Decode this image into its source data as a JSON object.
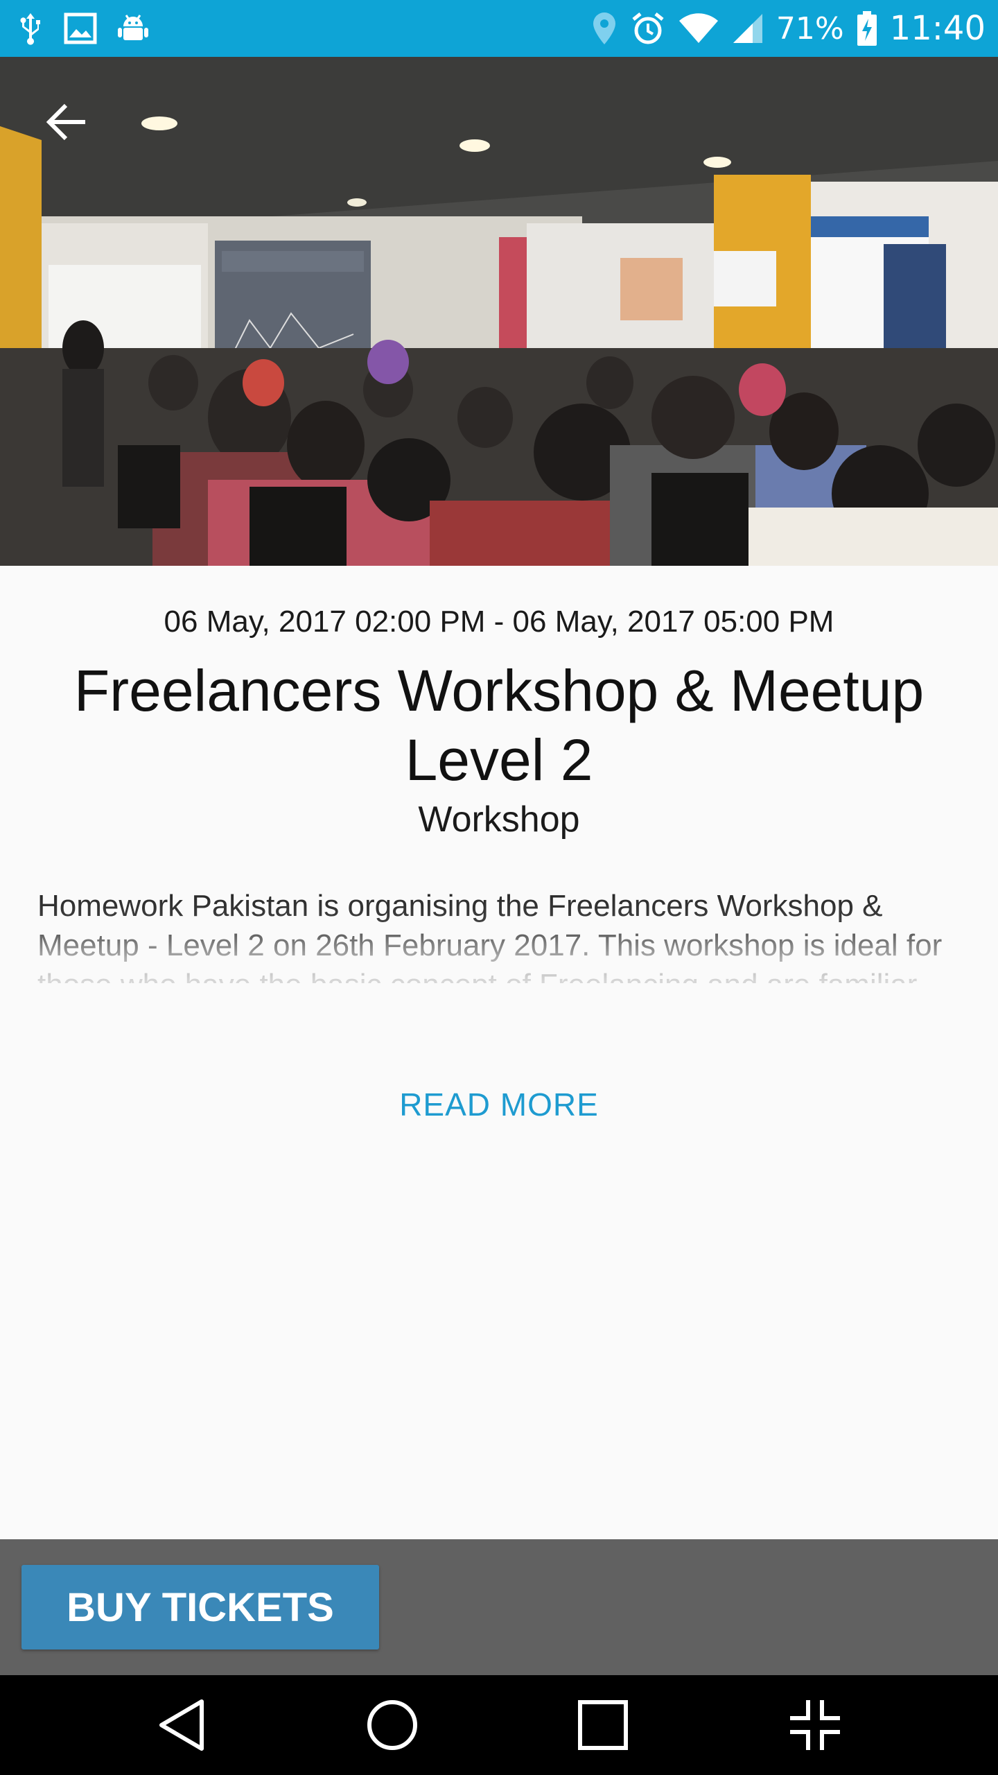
{
  "status_bar": {
    "battery_percent": "71%",
    "time": "11:40",
    "left_icons": [
      "usb-icon",
      "image-icon",
      "android-debug-icon"
    ],
    "right_icons": [
      "location-icon",
      "alarm-icon",
      "wifi-icon",
      "signal-icon",
      "battery-charging-icon"
    ],
    "background_color": "#0ea4d6"
  },
  "hero": {
    "back_icon": "arrow-back-icon",
    "image_alt": "Workshop audience photo"
  },
  "event": {
    "date_range": "06 May, 2017 02:00 PM - 06 May, 2017 05:00 PM",
    "title": "Freelancers Workshop & Meetup Level 2",
    "category": "Workshop",
    "description": "Homework Pakistan is organising the Freelancers Workshop & Meetup - Level 2 on 26th February 2017. This workshop is ideal for those who have the basic concept of Freelancing and are familiar with the",
    "read_more_label": "READ MORE",
    "accent_color": "#1e9bd0"
  },
  "action_bar": {
    "buy_tickets_label": "BUY TICKETS",
    "button_color": "#3a88b8",
    "bar_color": "#616161"
  },
  "nav_bar": {
    "buttons": [
      "back-icon",
      "home-icon",
      "recents-icon",
      "fullscreen-exit-icon"
    ]
  }
}
